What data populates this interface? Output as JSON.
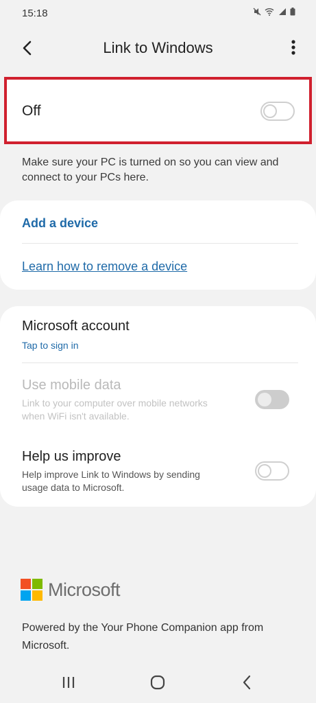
{
  "status_bar": {
    "time": "15:18",
    "icons": [
      "mute-icon",
      "wifi-icon",
      "signal-icon",
      "battery-icon"
    ]
  },
  "app_bar": {
    "title": "Link to Windows",
    "back_icon": "back-arrow-icon",
    "more_icon": "more-vertical-icon"
  },
  "master_switch": {
    "label": "Off",
    "checked": false
  },
  "hint": "Make sure your PC is turned on so you can view and connect to your PCs here.",
  "devices_card": {
    "add_device": "Add a device",
    "learn_remove": "Learn how to remove a device"
  },
  "settings_card": {
    "account": {
      "title": "Microsoft account",
      "subtitle": "Tap to sign in"
    },
    "mobile_data": {
      "title": "Use mobile data",
      "subtitle": "Link to your computer over mobile networks when WiFi isn't available.",
      "enabled": false,
      "checked": false
    },
    "help_improve": {
      "title": "Help us improve",
      "subtitle": "Help improve Link to Windows by sending usage data to Microsoft.",
      "checked": false
    }
  },
  "footer": {
    "brand": "Microsoft",
    "powered": "Powered by the Your Phone Companion app from Microsoft.",
    "logo_colors": [
      "#f25022",
      "#7fba00",
      "#00a4ef",
      "#ffb900"
    ]
  },
  "nav_bar": [
    "recents-icon",
    "home-icon",
    "back-icon"
  ],
  "colors": {
    "accent": "#1f6aa8",
    "highlight_border": "#d0202e",
    "background": "#f2f2f2"
  }
}
